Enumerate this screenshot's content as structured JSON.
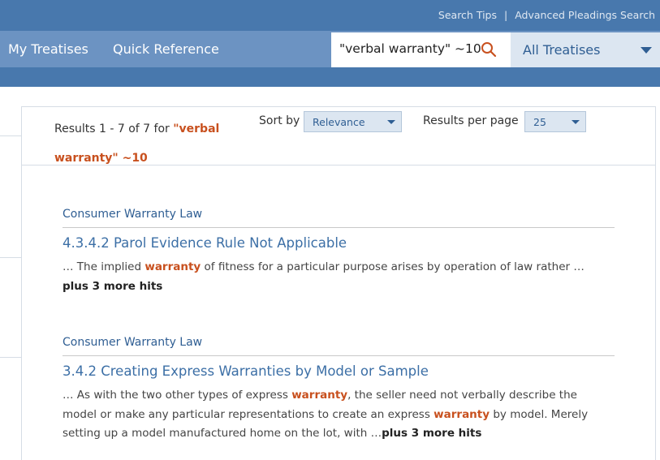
{
  "top_links": {
    "search_tips": "Search Tips",
    "separator": "|",
    "advanced": "Advanced Pleadings Search"
  },
  "nav": {
    "my_treatises": "My Treatises",
    "quick_reference": "Quick Reference"
  },
  "search": {
    "value": "\"verbal warranty\" ~10"
  },
  "scope": {
    "label": "All Treatises"
  },
  "results_header": {
    "count_prefix": "Results 1 - 7 of 7 for ",
    "query": "\"verbal warranty\" ~10",
    "sort_label": "Sort by",
    "sort_value": "Relevance",
    "per_page_label": "Results per page",
    "per_page_value": "25"
  },
  "results": [
    {
      "source": "Consumer Warranty Law",
      "title": "4.3.4.2 Parol Evidence Rule Not Applicable",
      "s1": "… The implied ",
      "h1": "warranty",
      "s2": " of fitness for a particular purpose arises by operation of law rather …",
      "more_hits": "plus 3 more hits"
    },
    {
      "source": "Consumer Warranty Law",
      "title": "3.4.2 Creating Express Warranties by Model or Sample",
      "s1": "… As with the two other types of express ",
      "h1": "warranty",
      "s2": ", the seller need not verbally describe the model or make any particular representations to create an express ",
      "h2": "warranty",
      "s3": " by model. Merely setting up a model manufactured home on the lot, with …",
      "more_hits": "plus 3 more hits"
    }
  ],
  "colors": {
    "header_dark": "#4878ad",
    "header_light": "#6c93c2",
    "highlight": "#c8501e",
    "link": "#3c6fa6"
  }
}
